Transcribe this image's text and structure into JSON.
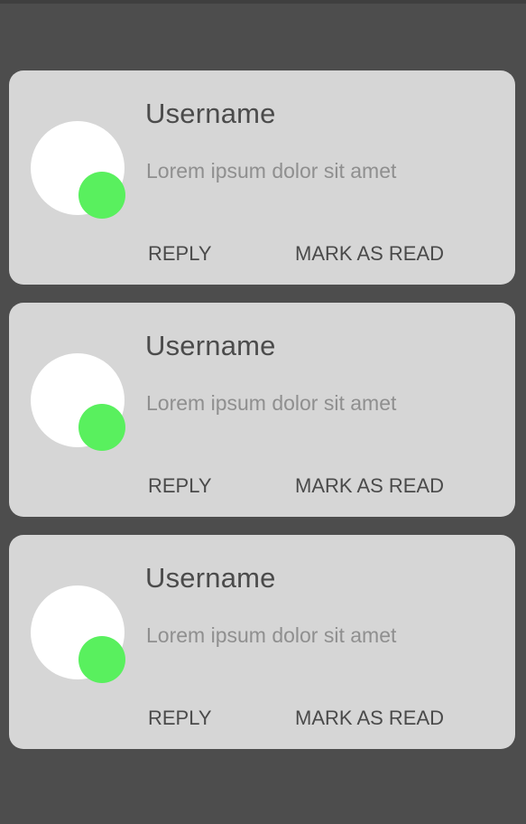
{
  "notifications": [
    {
      "username": "Username",
      "message": "Lorem ipsum dolor sit amet",
      "reply_label": "REPLY",
      "mark_read_label": "MARK AS READ",
      "online": true
    },
    {
      "username": "Username",
      "message": "Lorem ipsum dolor sit amet",
      "reply_label": "REPLY",
      "mark_read_label": "MARK AS READ",
      "online": true
    },
    {
      "username": "Username",
      "message": "Lorem ipsum dolor sit amet",
      "reply_label": "REPLY",
      "mark_read_label": "MARK AS READ",
      "online": true
    }
  ],
  "colors": {
    "background": "#4d4d4d",
    "card": "#d6d6d6",
    "avatar": "#ffffff",
    "status_online": "#59f05e",
    "username_text": "#4b4b4b",
    "message_text": "#8f8f8f",
    "action_text": "#4a4a4a"
  }
}
